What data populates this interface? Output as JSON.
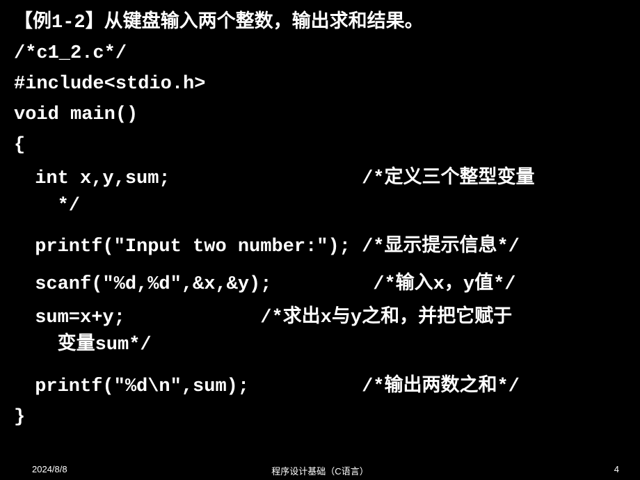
{
  "title": "【例1-2】从键盘输入两个整数，输出求和结果。",
  "code": {
    "line1": "/*c1_2.c*/",
    "line2": "#include<stdio.h>",
    "line3": "void main()",
    "line4": "{",
    "line5": " int x,y,sum;                 /*定义三个整型变量\n   */",
    "line6": " printf(\"Input two number:\"); /*显示提示信息*/",
    "line7": " scanf(\"%d,%d\",&x,&y);         /*输入x，y值*/",
    "line8": " sum=x+y;            /*求出x与y之和，并把它赋于\n   变量sum*/",
    "line9": " printf(\"%d\\n\",sum);          /*输出两数之和*/",
    "line10": "}"
  },
  "footer": {
    "date": "2024/8/8",
    "center": "程序设计基础（C语言）",
    "page": "4"
  }
}
